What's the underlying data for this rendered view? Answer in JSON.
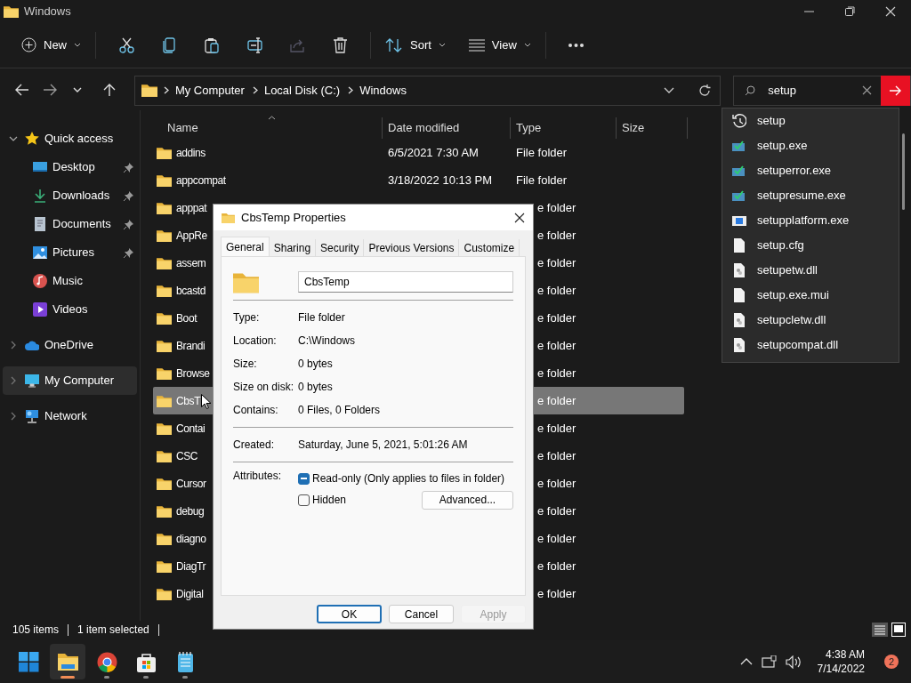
{
  "window": {
    "title": "Windows"
  },
  "toolbar": {
    "new_label": "New",
    "sort_label": "Sort",
    "view_label": "View",
    "share_disabled": true
  },
  "address": {
    "crumbs": [
      "My Computer",
      "Local Disk (C:)",
      "Windows"
    ]
  },
  "search": {
    "value": "setup",
    "suggestions": [
      {
        "kind": "history",
        "label": "setup"
      },
      {
        "kind": "app",
        "label": "setup.exe"
      },
      {
        "kind": "app",
        "label": "setuperror.exe"
      },
      {
        "kind": "app",
        "label": "setupresume.exe"
      },
      {
        "kind": "window",
        "label": "setupplatform.exe"
      },
      {
        "kind": "file",
        "label": "setup.cfg"
      },
      {
        "kind": "library",
        "label": "setupetw.dll"
      },
      {
        "kind": "file",
        "label": "setup.exe.mui"
      },
      {
        "kind": "library",
        "label": "setupcletw.dll"
      },
      {
        "kind": "library",
        "label": "setupcompat.dll"
      }
    ]
  },
  "nav": [
    {
      "kind": "star",
      "label": "Quick access",
      "expanded": true,
      "selected": false,
      "children": [
        {
          "kind": "desktop",
          "label": "Desktop",
          "pinned": true
        },
        {
          "kind": "download",
          "label": "Downloads",
          "pinned": true
        },
        {
          "kind": "document",
          "label": "Documents",
          "pinned": true
        },
        {
          "kind": "pictures",
          "label": "Pictures",
          "pinned": true
        },
        {
          "kind": "music",
          "label": "Music",
          "pinned": false
        },
        {
          "kind": "videos",
          "label": "Videos",
          "pinned": false
        }
      ]
    },
    {
      "kind": "cloud",
      "label": "OneDrive",
      "expanded": false,
      "selected": false
    },
    {
      "kind": "computer",
      "label": "My Computer",
      "expanded": false,
      "selected": true
    },
    {
      "kind": "network",
      "label": "Network",
      "expanded": false,
      "selected": false
    }
  ],
  "columns": [
    "Name",
    "Date modified",
    "Type",
    "Size"
  ],
  "rows": [
    {
      "name": "addins",
      "date": "6/5/2021 7:30 AM",
      "type": "File folder",
      "covered": false,
      "selected": false
    },
    {
      "name": "appcompat",
      "date": "3/18/2022 10:13 PM",
      "type": "File folder",
      "covered": false,
      "selected": false
    },
    {
      "name": "apppat",
      "type": "e folder",
      "covered": true,
      "selected": false
    },
    {
      "name": "AppRe",
      "type": "e folder",
      "covered": true,
      "selected": false
    },
    {
      "name": "assem",
      "type": "e folder",
      "covered": true,
      "selected": false
    },
    {
      "name": "bcastd",
      "type": "e folder",
      "covered": true,
      "selected": false
    },
    {
      "name": "Boot",
      "type": "e folder",
      "covered": true,
      "selected": false
    },
    {
      "name": "Brandi",
      "type": "e folder",
      "covered": true,
      "selected": false
    },
    {
      "name": "Browse",
      "type": "e folder",
      "covered": true,
      "selected": false
    },
    {
      "name": "CbsT",
      "type": "e folder",
      "covered": true,
      "selected": true
    },
    {
      "name": "Contai",
      "type": "e folder",
      "covered": true,
      "selected": false
    },
    {
      "name": "CSC",
      "type": "e folder",
      "covered": true,
      "selected": false
    },
    {
      "name": "Cursor",
      "type": "e folder",
      "covered": true,
      "selected": false
    },
    {
      "name": "debug",
      "type": "e folder",
      "covered": true,
      "selected": false
    },
    {
      "name": "diagno",
      "type": "e folder",
      "covered": true,
      "selected": false
    },
    {
      "name": "DiagTr",
      "type": "e folder",
      "covered": true,
      "selected": false
    },
    {
      "name": "Digital",
      "type": "e folder",
      "covered": true,
      "selected": false
    }
  ],
  "status": {
    "count": "105 items",
    "selection": "1 item selected"
  },
  "dialog": {
    "title": "CbsTemp Properties",
    "tabs": [
      {
        "label": "General",
        "selected": true
      },
      {
        "label": "Sharing",
        "selected": false
      },
      {
        "label": "Security",
        "selected": false
      },
      {
        "label": "Previous Versions",
        "selected": false
      },
      {
        "label": "Customize",
        "selected": false
      }
    ],
    "name_value": "CbsTemp",
    "groups": [
      [
        {
          "label": "Type:",
          "value": "File folder"
        },
        {
          "label": "Location:",
          "value": "C:\\Windows"
        },
        {
          "label": "Size:",
          "value": "0 bytes"
        },
        {
          "label": "Size on disk:",
          "value": "0 bytes"
        },
        {
          "label": "Contains:",
          "value": "0 Files, 0 Folders"
        }
      ],
      [
        {
          "label": "Created:",
          "value": "Saturday, June 5, 2021, 5:01:26 AM"
        }
      ]
    ],
    "attributes_label": "Attributes:",
    "attributes": [
      {
        "label": "Read-only (Only applies to files in folder)",
        "indeterminate": true
      },
      {
        "label": "Hidden",
        "indeterminate": false
      }
    ],
    "advanced_label": "Advanced...",
    "buttons": [
      {
        "label": "OK",
        "default": true,
        "disabled": false
      },
      {
        "label": "Cancel",
        "default": false,
        "disabled": false
      },
      {
        "label": "Apply",
        "default": false,
        "disabled": true
      }
    ]
  },
  "taskbar": {
    "apps": [
      {
        "kind": "start",
        "active": false,
        "running": false
      },
      {
        "kind": "folder",
        "active": true,
        "running": true
      },
      {
        "kind": "browser",
        "active": false,
        "running": true
      },
      {
        "kind": "store",
        "active": false,
        "running": true
      },
      {
        "kind": "notepad",
        "active": false,
        "running": true
      }
    ],
    "time": "4:38 AM",
    "date": "7/14/2022",
    "badge": "2"
  }
}
